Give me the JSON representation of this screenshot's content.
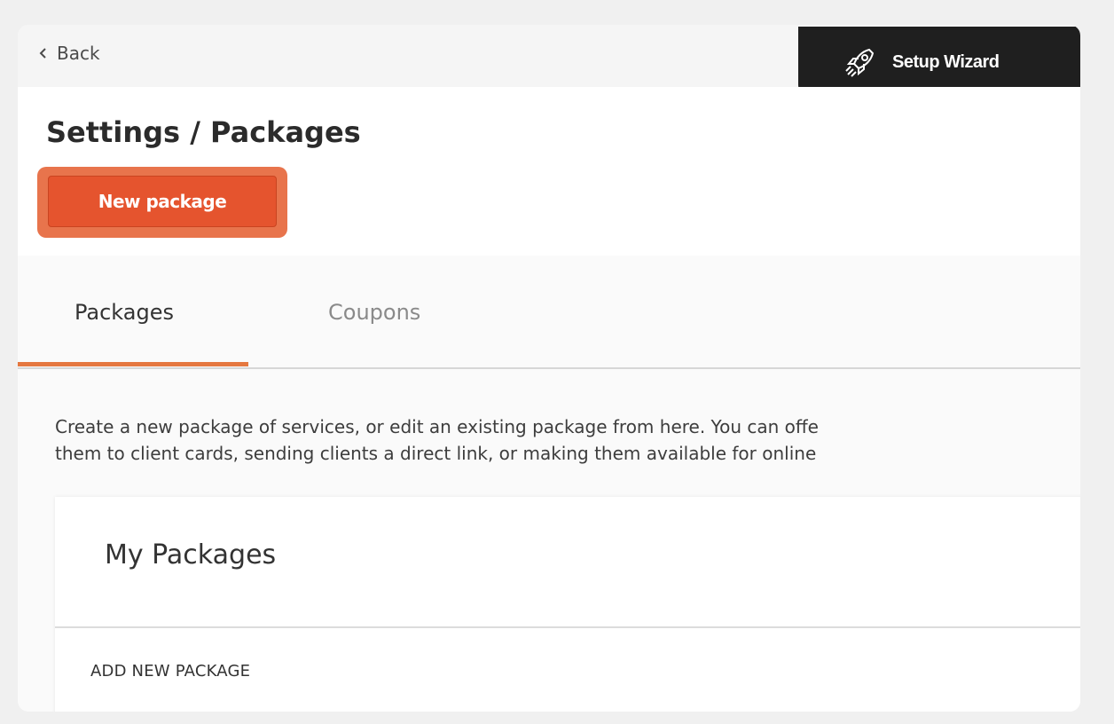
{
  "header": {
    "back_label": "Back",
    "wizard_label": "Setup Wizard"
  },
  "page": {
    "title": "Settings / Packages",
    "new_package_label": "New package"
  },
  "tabs": [
    {
      "label": "Packages",
      "active": true
    },
    {
      "label": "Coupons",
      "active": false
    }
  ],
  "description": {
    "line1": "Create a new package of services, or edit an existing package from here. You can offe",
    "line2": "them to client cards, sending clients a direct link, or making them available for online"
  },
  "card": {
    "title": "My Packages",
    "add_link_label": "ADD NEW PACKAGE"
  },
  "colors": {
    "accent": "#e5542e",
    "tab_underline": "#e5773f",
    "wizard_bg": "#1f1f1f"
  },
  "icons": {
    "back": "chevron-left-icon",
    "wizard": "rocket-icon"
  }
}
